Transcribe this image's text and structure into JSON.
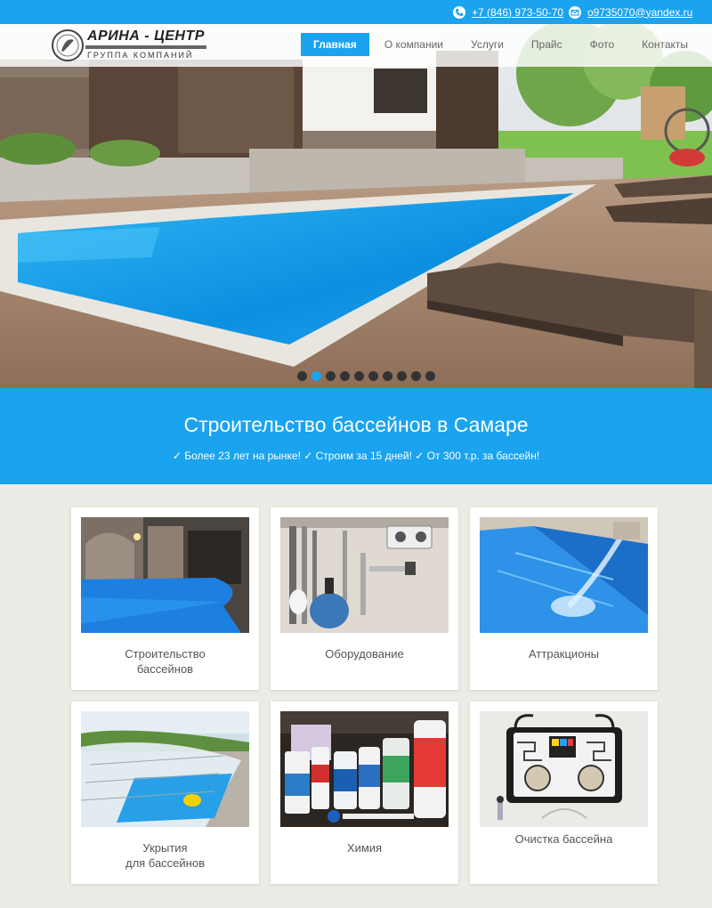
{
  "topbar": {
    "phone": "+7 (846) 973-50-70",
    "email": "o9735070@yandex.ru",
    "phone_icon": "phone-icon",
    "email_icon": "mail-icon"
  },
  "logo": {
    "title": "АРИНА - ЦЕНТР",
    "subtitle": "ГРУППА КОМПАНИЙ"
  },
  "nav": [
    {
      "label": "Главная",
      "active": true
    },
    {
      "label": "О компании",
      "active": false
    },
    {
      "label": "Услуги",
      "active": false
    },
    {
      "label": "Прайс",
      "active": false
    },
    {
      "label": "Фото",
      "active": false
    },
    {
      "label": "Контакты",
      "active": false
    }
  ],
  "slider": {
    "count": 10,
    "active_index": 1
  },
  "banner": {
    "title": "Строительство бассейнов в Самаре",
    "tagline": "✓ Более 23 лет на рынке!  ✓ Строим за 15 дней!  ✓ От 300 т.р. за бассейн!"
  },
  "cards": [
    {
      "label": "Строительство\nбассейнов"
    },
    {
      "label": "Оборудование"
    },
    {
      "label": "Аттракционы"
    },
    {
      "label": "Укрытия\nдля бассейнов"
    },
    {
      "label": "Химия"
    },
    {
      "label": "Очистка бассейна"
    }
  ],
  "colors": {
    "accent": "#1aa3ef",
    "background": "#ecebe6",
    "dot_inactive": "#333333"
  }
}
